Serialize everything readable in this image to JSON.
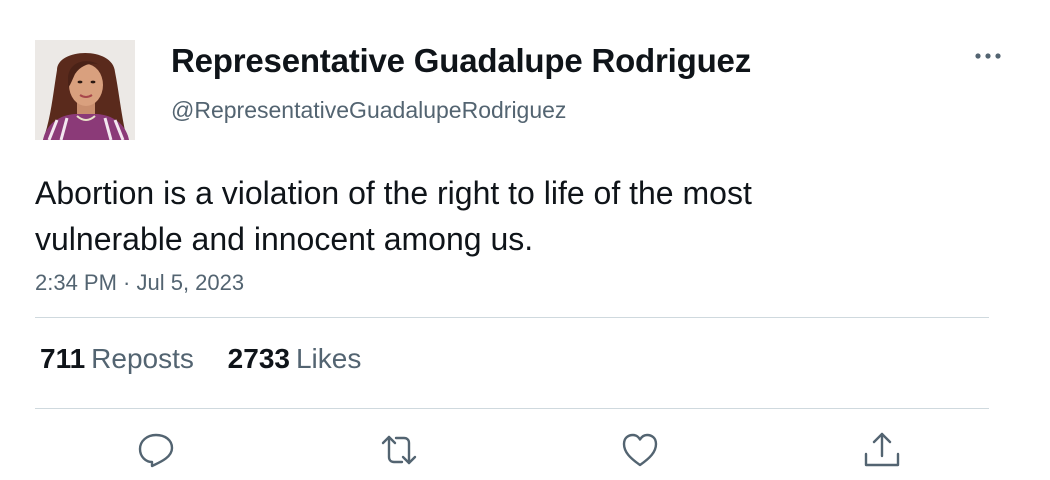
{
  "author": {
    "display_name": "Representative Guadalupe Rodriguez",
    "handle": "@RepresentativeGuadalupeRodriguez"
  },
  "tweet": {
    "text": "Abortion is a violation of the right to life of the most vulnerable and innocent among us.",
    "timestamp": "2:34 PM · Jul 5, 2023"
  },
  "stats": {
    "reposts_count": "711",
    "reposts_label": "Reposts",
    "likes_count": "2733",
    "likes_label": "Likes"
  },
  "icons": {
    "more": "more-horizontal-icon",
    "reply": "reply-bubble-icon",
    "repost": "repost-arrows-icon",
    "like": "heart-icon",
    "share": "share-upload-icon"
  },
  "colors": {
    "text_primary": "#0f1419",
    "text_secondary": "#536471",
    "divider": "#cfd9de",
    "icon": "#536471"
  }
}
